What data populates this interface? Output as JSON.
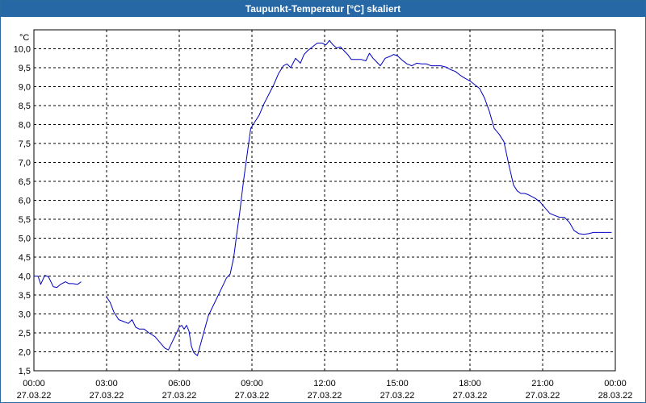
{
  "window": {
    "title": "Taupunkt-Temperatur [°C] skaliert"
  },
  "colors": {
    "titlebar": "#2668a6",
    "line": "#0000c0",
    "grid": "#000000",
    "background": "#ffffff"
  },
  "chart_data": {
    "type": "line",
    "title": "Taupunkt-Temperatur [°C] skaliert",
    "ylabel": "°C",
    "xlabel": "",
    "ylim": [
      1.5,
      10.5
    ],
    "xlim": [
      0,
      24
    ],
    "grid": true,
    "legend": "none",
    "y_ticks": [
      "1,5",
      "2,0",
      "2,5",
      "3,0",
      "3,5",
      "4,0",
      "4,5",
      "5,0",
      "5,5",
      "6,0",
      "6,5",
      "7,0",
      "7,5",
      "8,0",
      "8,5",
      "9,0",
      "9,5",
      "10,0"
    ],
    "x_ticks": [
      {
        "time": "00:00",
        "date": "27.03.22"
      },
      {
        "time": "03:00",
        "date": "27.03.22"
      },
      {
        "time": "06:00",
        "date": "27.03.22"
      },
      {
        "time": "09:00",
        "date": "27.03.22"
      },
      {
        "time": "12:00",
        "date": "27.03.22"
      },
      {
        "time": "15:00",
        "date": "27.03.22"
      },
      {
        "time": "18:00",
        "date": "27.03.22"
      },
      {
        "time": "21:00",
        "date": "27.03.22"
      },
      {
        "time": "00:00",
        "date": "28.03.22"
      }
    ],
    "series": [
      {
        "segments": [
          {
            "x": [
              0.0,
              0.17,
              0.28,
              0.45,
              0.6,
              0.8,
              0.95,
              1.1,
              1.3,
              1.45,
              1.6,
              1.8,
              1.95
            ],
            "y": [
              4.0,
              4.0,
              3.78,
              4.02,
              3.98,
              3.72,
              3.7,
              3.78,
              3.85,
              3.8,
              3.8,
              3.78,
              3.85
            ]
          },
          {
            "x": [
              3.0,
              3.15,
              3.3,
              3.5,
              3.7,
              3.9,
              4.05,
              4.2,
              4.35,
              4.55,
              4.75,
              5.0,
              5.2,
              5.4,
              5.55,
              5.7,
              5.85,
              6.0,
              6.1,
              6.2,
              6.3,
              6.4,
              6.5,
              6.6,
              6.65,
              6.75,
              6.9,
              7.05,
              7.2,
              7.35,
              7.5,
              7.65,
              7.8,
              7.95,
              8.1,
              8.25,
              8.35,
              8.5,
              8.65,
              8.8,
              8.95,
              9.1,
              9.3,
              9.5,
              9.7,
              9.9,
              10.1,
              10.3,
              10.45,
              10.6,
              10.8,
              11.0,
              11.15,
              11.3,
              11.5,
              11.7,
              11.9,
              12.05,
              12.2,
              12.35,
              12.5,
              12.65,
              12.8,
              12.95,
              13.1,
              13.3,
              13.5,
              13.7,
              13.85,
              14.0,
              14.15,
              14.3,
              14.5,
              14.7,
              14.85,
              15.0,
              15.2,
              15.4,
              15.6,
              15.8,
              16.0,
              16.2,
              16.4,
              16.6,
              16.8,
              17.0,
              17.2,
              17.4,
              17.6,
              17.8,
              18.0,
              18.2,
              18.4,
              18.6,
              18.8,
              19.0,
              19.2,
              19.4,
              19.6,
              19.8,
              19.95,
              20.1,
              20.25,
              20.4,
              20.55,
              20.7,
              20.9,
              21.1,
              21.3,
              21.5,
              21.7,
              21.9,
              22.1,
              22.3,
              22.5,
              22.7,
              22.9,
              23.1,
              23.3,
              23.5,
              23.7,
              23.85
            ],
            "y": [
              3.45,
              3.3,
              3.05,
              2.85,
              2.8,
              2.75,
              2.85,
              2.65,
              2.6,
              2.6,
              2.5,
              2.4,
              2.25,
              2.1,
              2.05,
              2.25,
              2.45,
              2.65,
              2.7,
              2.6,
              2.7,
              2.55,
              2.15,
              1.98,
              1.95,
              1.9,
              2.25,
              2.6,
              2.95,
              3.15,
              3.35,
              3.55,
              3.75,
              3.95,
              4.05,
              4.5,
              5.0,
              5.7,
              6.5,
              7.2,
              7.9,
              8.05,
              8.25,
              8.55,
              8.8,
              9.05,
              9.35,
              9.55,
              9.6,
              9.5,
              9.75,
              9.62,
              9.85,
              9.95,
              10.05,
              10.15,
              10.15,
              10.1,
              10.22,
              10.1,
              10.02,
              10.05,
              9.95,
              9.85,
              9.72,
              9.72,
              9.72,
              9.68,
              9.88,
              9.75,
              9.65,
              9.55,
              9.75,
              9.8,
              9.85,
              9.82,
              9.7,
              9.6,
              9.55,
              9.62,
              9.6,
              9.6,
              9.55,
              9.55,
              9.55,
              9.52,
              9.45,
              9.4,
              9.3,
              9.22,
              9.15,
              9.05,
              8.95,
              8.7,
              8.35,
              7.9,
              7.75,
              7.55,
              6.95,
              6.4,
              6.25,
              6.18,
              6.18,
              6.15,
              6.1,
              6.05,
              5.95,
              5.8,
              5.65,
              5.6,
              5.55,
              5.55,
              5.42,
              5.2,
              5.12,
              5.1,
              5.12,
              5.15,
              5.15,
              5.15,
              5.15,
              5.15
            ]
          }
        ]
      }
    ]
  }
}
